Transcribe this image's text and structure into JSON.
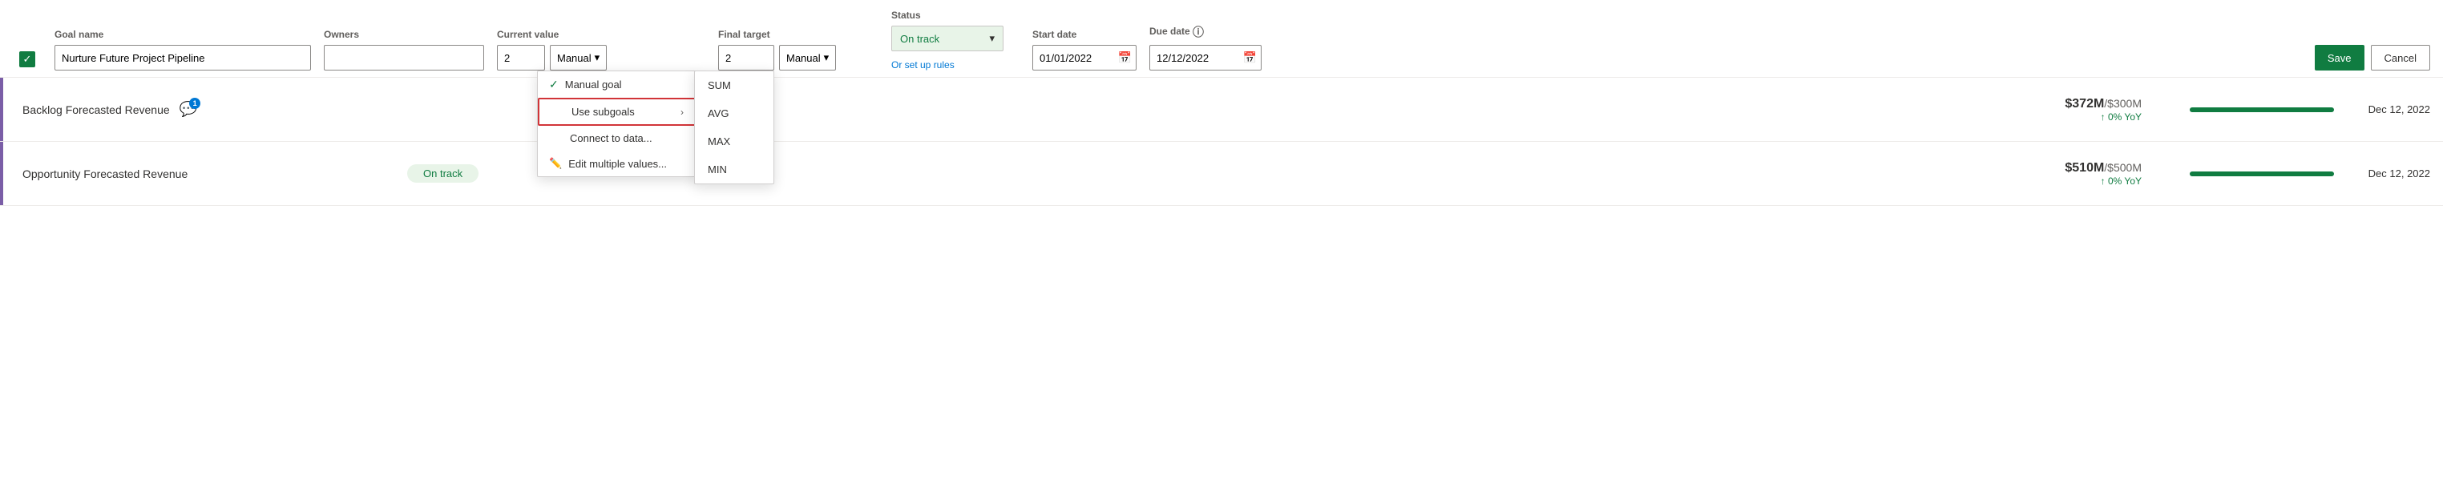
{
  "header": {
    "columns": {
      "goal_name_label": "Goal name",
      "owners_label": "Owners",
      "current_value_label": "Current value",
      "final_target_label": "Final target",
      "status_label": "Status",
      "start_date_label": "Start date",
      "due_date_label": "Due date"
    },
    "form": {
      "goal_name_value": "Nurture Future Project Pipeline",
      "goal_name_placeholder": "Goal name",
      "owners_placeholder": "",
      "current_value": "2",
      "current_value_method": "Manual",
      "final_target_value": "2",
      "final_target_method": "Manual",
      "status_value": "On track",
      "set_up_rules_label": "Or set up rules",
      "start_date_value": "01/01/2022",
      "due_date_value": "12/12/2022"
    },
    "buttons": {
      "save_label": "Save",
      "cancel_label": "Cancel"
    }
  },
  "dropdown_menu": {
    "items": [
      {
        "id": "manual-goal",
        "label": "Manual goal",
        "checked": true,
        "has_arrow": false
      },
      {
        "id": "use-subgoals",
        "label": "Use subgoals",
        "checked": false,
        "has_arrow": true,
        "highlighted": true
      },
      {
        "id": "connect-to-data",
        "label": "Connect to data...",
        "checked": false,
        "has_arrow": false
      },
      {
        "id": "edit-multiple-values",
        "label": "Edit multiple values...",
        "checked": false,
        "has_arrow": false,
        "icon": "pencil"
      }
    ]
  },
  "submenu": {
    "items": [
      {
        "id": "sum",
        "label": "SUM"
      },
      {
        "id": "avg",
        "label": "AVG"
      },
      {
        "id": "max",
        "label": "MAX"
      },
      {
        "id": "min",
        "label": "MIN"
      }
    ]
  },
  "rows": [
    {
      "id": "row-1",
      "name": "Backlog Forecasted Revenue",
      "has_comment": true,
      "comment_count": 1,
      "status": "",
      "current_value_main": "$372M",
      "current_value_target": "/$300M",
      "current_value_sub": "↑ 0% YoY",
      "progress_pct": 100,
      "due_date": "Dec 12, 2022"
    },
    {
      "id": "row-2",
      "name": "Opportunity Forecasted Revenue",
      "has_comment": false,
      "comment_count": 0,
      "status": "On track",
      "current_value_main": "$510M",
      "current_value_target": "/$500M",
      "current_value_sub": "↑ 0% YoY",
      "progress_pct": 100,
      "due_date": "Dec 12, 2022"
    }
  ]
}
